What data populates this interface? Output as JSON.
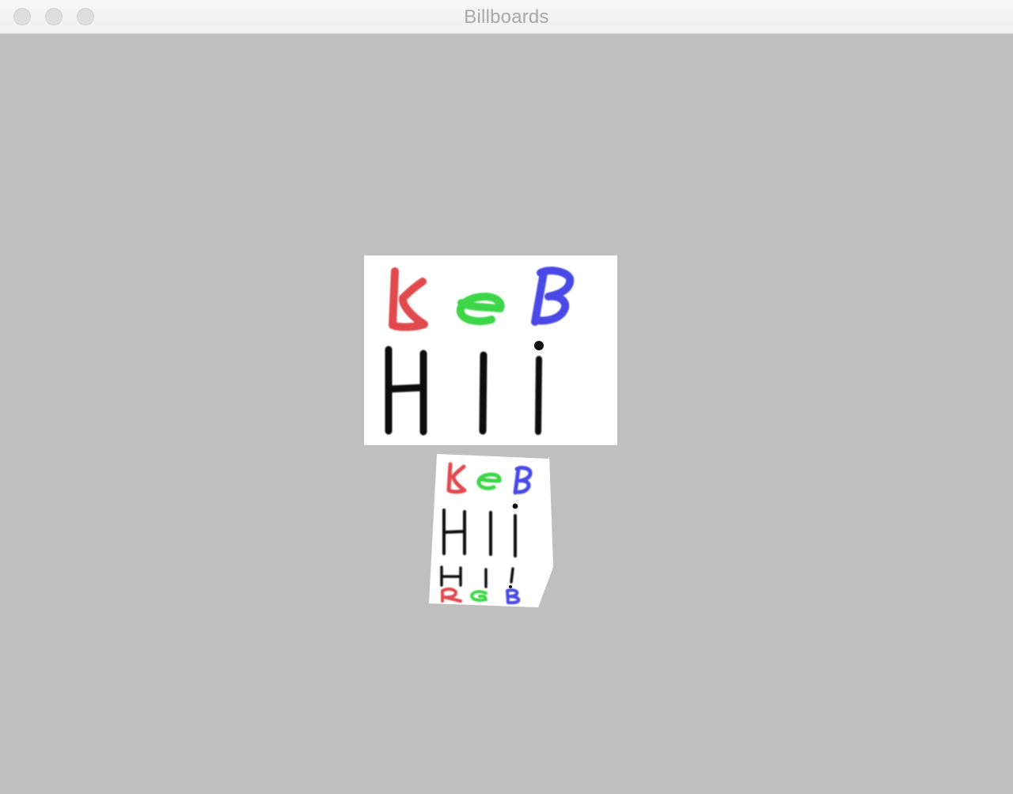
{
  "window": {
    "title": "Billboards"
  },
  "scene": {
    "background": "#bfbfbf",
    "billboard": {
      "top_row": [
        "k",
        "e",
        "B"
      ],
      "bottom_row": [
        "H",
        "l",
        "i"
      ],
      "colors": {
        "red": "#e0484e",
        "green": "#3dd64a",
        "blue": "#4a4ae6",
        "black": "#111111",
        "panel": "#ffffff"
      }
    },
    "cube": {
      "front_top_row": [
        "k",
        "e",
        "B"
      ],
      "front_bottom_row": [
        "H",
        "l",
        "i"
      ],
      "side_top_row": [
        "H",
        "l",
        "!"
      ],
      "side_bottom_row": [
        "R",
        "G",
        "B"
      ]
    }
  }
}
